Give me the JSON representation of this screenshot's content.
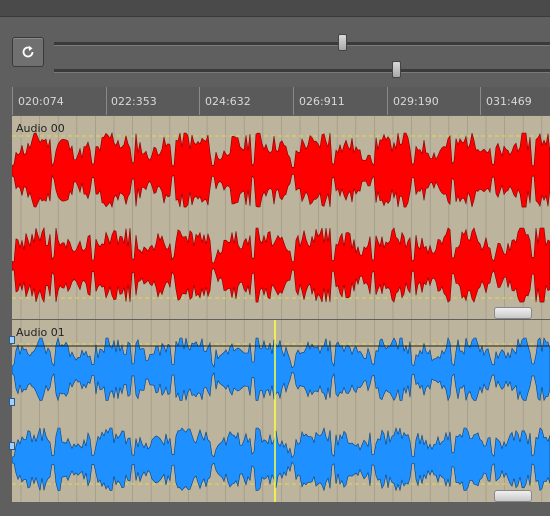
{
  "toolbar": {
    "loop_icon": "loop-icon",
    "slider1_value": 0.58,
    "slider2_value": 0.69
  },
  "ruler": {
    "labels": [
      "020:074",
      "022:353",
      "024:632",
      "026:911",
      "029:190",
      "031:469"
    ]
  },
  "tracks": [
    {
      "name": "Audio 00",
      "color": "#ff0000",
      "outline": "#7a0000",
      "background": "#bdb49e"
    },
    {
      "name": "Audio 01",
      "color": "#1e90ff",
      "outline": "#0b3f73",
      "background": "#bdb49e"
    }
  ],
  "colors": {
    "cursor": "#ffff40",
    "guide": "#e6d84a",
    "gridline": "#8f8a7c"
  }
}
